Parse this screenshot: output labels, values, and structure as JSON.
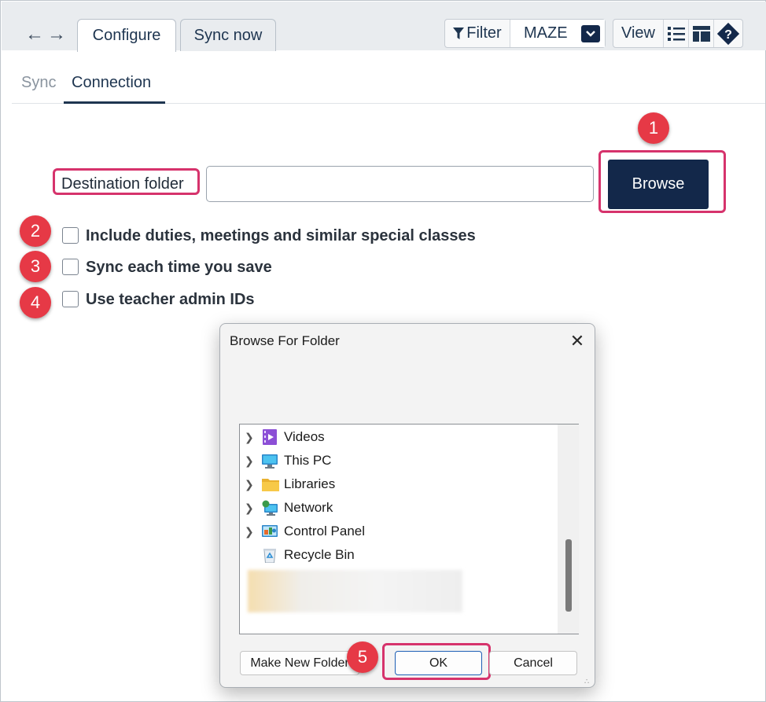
{
  "toolbar": {
    "tabs": [
      {
        "label": "Configure",
        "active": true
      },
      {
        "label": "Sync now",
        "active": false
      }
    ],
    "filter_label": "Filter",
    "filter_value": "MAZE",
    "view_label": "View"
  },
  "subtabs": [
    {
      "label": "Sync",
      "active": false
    },
    {
      "label": "Connection",
      "active": true
    }
  ],
  "form": {
    "destination_label": "Destination folder",
    "destination_value": "",
    "browse_label": "Browse",
    "checkboxes": [
      {
        "label": "Include duties, meetings and similar special classes",
        "checked": false
      },
      {
        "label": "Sync each time you save",
        "checked": false
      },
      {
        "label": "Use teacher admin IDs",
        "checked": false
      }
    ]
  },
  "callouts": [
    "1",
    "2",
    "3",
    "4",
    "5"
  ],
  "dialog": {
    "title": "Browse For Folder",
    "items": [
      {
        "label": "Videos",
        "icon": "videos-folder-icon",
        "expandable": true
      },
      {
        "label": "This PC",
        "icon": "computer-icon",
        "expandable": true
      },
      {
        "label": "Libraries",
        "icon": "libraries-folder-icon",
        "expandable": true
      },
      {
        "label": "Network",
        "icon": "network-icon",
        "expandable": true
      },
      {
        "label": "Control Panel",
        "icon": "control-panel-icon",
        "expandable": true
      },
      {
        "label": "Recycle Bin",
        "icon": "recycle-bin-icon",
        "expandable": false
      }
    ],
    "buttons": {
      "new_folder": "Make New Folder",
      "ok": "OK",
      "cancel": "Cancel"
    }
  },
  "colors": {
    "accent_navy": "#13284a",
    "highlight": "#d6336c",
    "callout": "#e63946"
  }
}
